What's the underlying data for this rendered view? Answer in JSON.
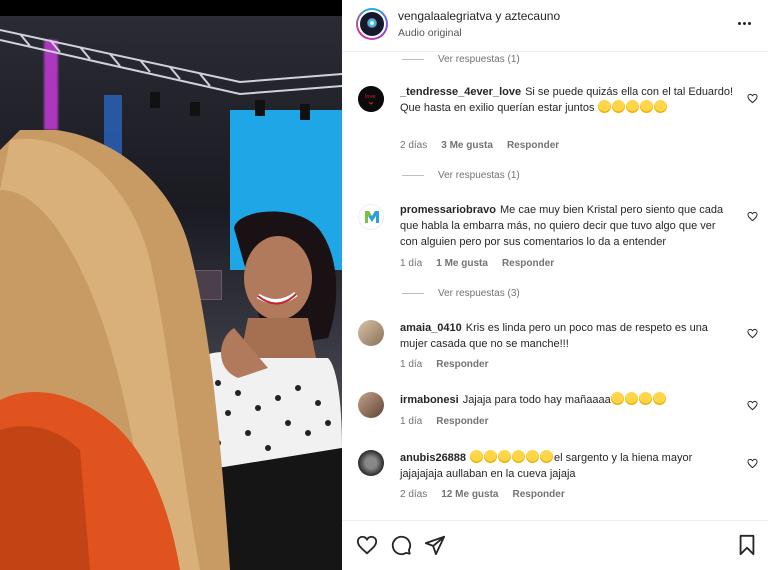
{
  "header": {
    "title": "vengalaalegriatva y aztecauno",
    "subtitle": "Audio original"
  },
  "view_replies": [
    "Ver respuestas (1)",
    "Ver respuestas (1)",
    "Ver respuestas (3)"
  ],
  "comments": [
    {
      "user": "_tendresse_4ever_love",
      "text": "Si se puede quizás ella con el tal Eduardo! Que hasta en exilio querían estar juntos",
      "emoji_after": 5,
      "time": "2 días",
      "likes": "3 Me gusta",
      "reply": "Responder"
    },
    {
      "user": "promessariobravo",
      "text": "Me cae muy bien Kristal pero siento que cada que habla la embarra más, no quiero decir que tuvo algo que ver con alguien pero por sus comentarios lo da a entender",
      "time": "1 día",
      "likes": "1 Me gusta",
      "reply": "Responder"
    },
    {
      "user": "amaia_0410",
      "text": "Kris es linda pero un poco mas de respeto es una mujer casada que no se manche!!!",
      "time": "1 día",
      "reply": "Responder"
    },
    {
      "user": "irmabonesi",
      "text": "Jajaja para todo hay mañaaaa",
      "emoji_after": 4,
      "time": "1 día",
      "reply": "Responder"
    },
    {
      "user": "anubis26888",
      "text_before_emoji": "",
      "emoji_before": 6,
      "text": "el sargento y la hiena mayor jajajajaja aullaban en la cueva jajaja",
      "time": "2 días",
      "likes": "12 Me gusta",
      "reply": "Responder"
    }
  ],
  "icons": {
    "more": "more-horizontal-icon",
    "like": "heart-icon",
    "comment": "comment-icon",
    "share": "paper-plane-icon",
    "save": "bookmark-icon"
  },
  "colors": {
    "text": "#262626",
    "muted": "#737373",
    "stage_blue": "#1fa6e6"
  }
}
